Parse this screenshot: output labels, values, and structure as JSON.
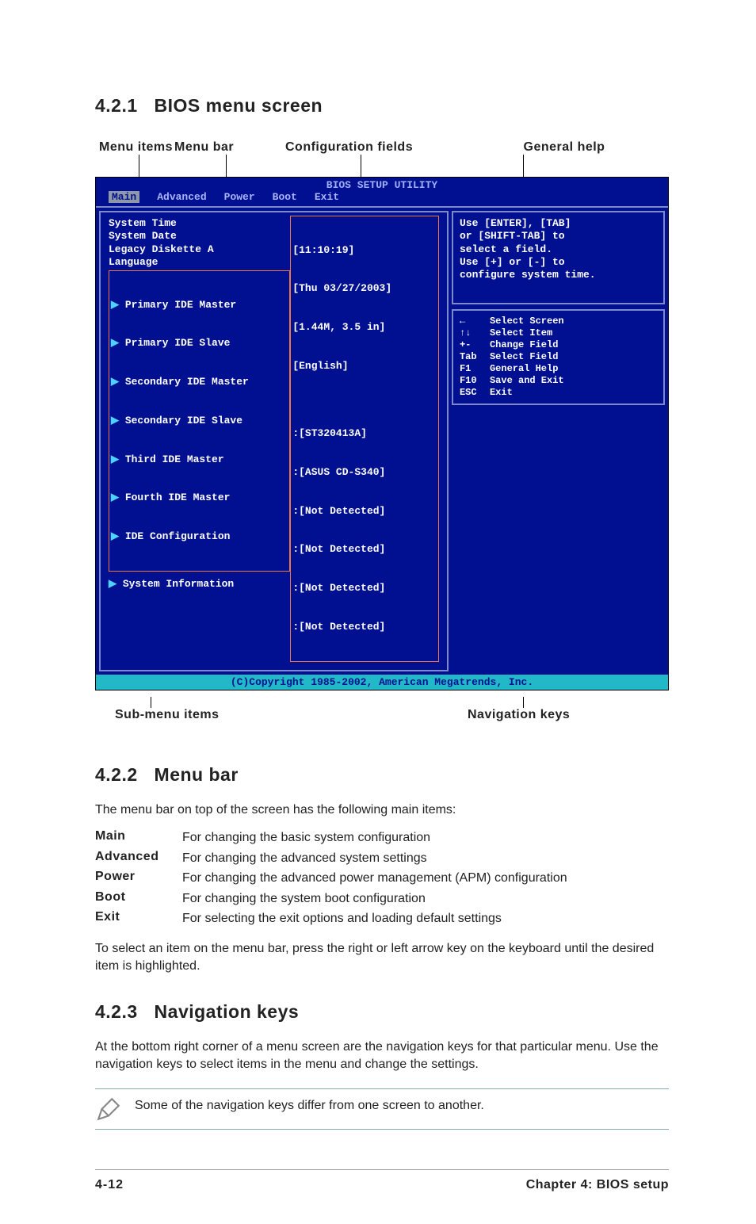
{
  "section_421_num": "4.2.1",
  "section_421_title": "BIOS menu screen",
  "callout_top": {
    "c1": "Menu items",
    "c2": "Menu bar",
    "c3": "Configuration fields",
    "c4": "General help"
  },
  "bios": {
    "title": "BIOS SETUP UTILITY",
    "menubar": [
      "Main",
      "Advanced",
      "Power",
      "Boot",
      "Exit"
    ],
    "left_plain": [
      "System Time",
      "System Date",
      "Legacy Diskette A",
      "Language"
    ],
    "left_sub": [
      "Primary IDE Master",
      "Primary IDE Slave",
      "Secondary IDE Master",
      "Secondary IDE Slave",
      "Third IDE Master",
      "Fourth IDE Master",
      "IDE Configuration"
    ],
    "left_sub2": "System Information",
    "vals_plain": [
      "[11:10:19]",
      "[Thu 03/27/2003]",
      "[1.44M, 3.5 in]",
      "[English]"
    ],
    "vals_sub": [
      ":[ST320413A]",
      ":[ASUS CD-S340]",
      ":[Not Detected]",
      ":[Not Detected]",
      ":[Not Detected]",
      ":[Not Detected]"
    ],
    "help": [
      "Use [ENTER], [TAB]",
      "or [SHIFT-TAB] to",
      "select a field.",
      "",
      "Use [+] or [-] to",
      "configure system time."
    ],
    "nav": [
      {
        "k": "←",
        "v": "Select Screen"
      },
      {
        "k": "↑↓",
        "v": "Select Item"
      },
      {
        "k": "+-",
        "v": "Change Field"
      },
      {
        "k": "Tab",
        "v": "Select Field"
      },
      {
        "k": "F1",
        "v": "General Help"
      },
      {
        "k": "F10",
        "v": "Save and Exit"
      },
      {
        "k": "ESC",
        "v": "Exit"
      }
    ],
    "footer": "(C)Copyright 1985-2002, American Megatrends, Inc."
  },
  "callout_bottom": {
    "c1": "Sub-menu items",
    "c2": "Navigation keys"
  },
  "section_422_num": "4.2.2",
  "section_422_title": "Menu bar",
  "s422_intro": "The menu bar on top of the screen has the following main items:",
  "menubar_items": [
    {
      "t": "Main",
      "d": "For changing the basic system configuration"
    },
    {
      "t": "Advanced",
      "d": "For changing the advanced system settings"
    },
    {
      "t": "Power",
      "d": "For changing the advanced power management (APM) configuration"
    },
    {
      "t": "Boot",
      "d": "For changing the system boot configuration"
    },
    {
      "t": "Exit",
      "d": "For selecting the exit options and loading default settings"
    }
  ],
  "s422_outro": "To select an item on the menu bar, press the right or left arrow key on the keyboard until the desired item is highlighted.",
  "section_423_num": "4.2.3",
  "section_423_title": "Navigation keys",
  "s423_body": "At the bottom right corner of a menu screen are the navigation keys for that particular menu. Use the navigation keys to select items in the menu and change the settings.",
  "note": "Some of the navigation keys differ from one screen to another.",
  "footer_page": "4-12",
  "footer_chapter": "Chapter 4: BIOS setup"
}
